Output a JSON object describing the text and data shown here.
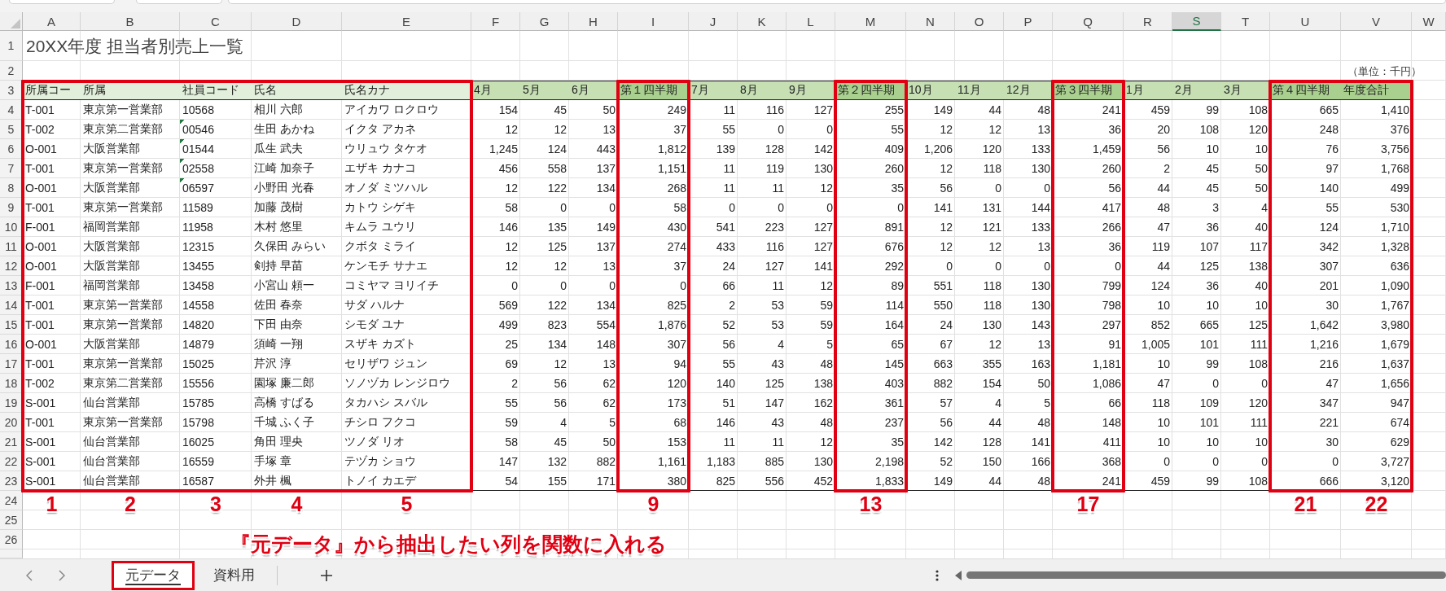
{
  "columns": [
    {
      "letter": "A",
      "selected": false,
      "highlighted": true,
      "marker": "1"
    },
    {
      "letter": "B",
      "selected": false,
      "highlighted": true,
      "marker": "2"
    },
    {
      "letter": "C",
      "selected": false,
      "highlighted": true,
      "marker": "3"
    },
    {
      "letter": "D",
      "selected": false,
      "highlighted": true,
      "marker": "4"
    },
    {
      "letter": "E",
      "selected": false,
      "highlighted": true,
      "marker": "5"
    },
    {
      "letter": "F",
      "selected": false,
      "highlighted": false
    },
    {
      "letter": "G",
      "selected": false,
      "highlighted": false
    },
    {
      "letter": "H",
      "selected": false,
      "highlighted": false
    },
    {
      "letter": "I",
      "selected": false,
      "highlighted": true,
      "marker": "9"
    },
    {
      "letter": "J",
      "selected": false,
      "highlighted": false
    },
    {
      "letter": "K",
      "selected": false,
      "highlighted": false
    },
    {
      "letter": "L",
      "selected": false,
      "highlighted": false
    },
    {
      "letter": "M",
      "selected": false,
      "highlighted": true,
      "marker": "13"
    },
    {
      "letter": "N",
      "selected": false,
      "highlighted": false
    },
    {
      "letter": "O",
      "selected": false,
      "highlighted": false
    },
    {
      "letter": "P",
      "selected": false,
      "highlighted": false
    },
    {
      "letter": "Q",
      "selected": false,
      "highlighted": true,
      "marker": "17"
    },
    {
      "letter": "R",
      "selected": false,
      "highlighted": false
    },
    {
      "letter": "S",
      "selected": true,
      "highlighted": false
    },
    {
      "letter": "T",
      "selected": false,
      "highlighted": false
    },
    {
      "letter": "U",
      "selected": false,
      "highlighted": true,
      "marker": "21"
    },
    {
      "letter": "V",
      "selected": false,
      "highlighted": true,
      "marker": "22"
    },
    {
      "letter": "W",
      "selected": false,
      "highlighted": false
    }
  ],
  "row_numbers": [
    "1",
    "2",
    "3",
    "4",
    "5",
    "6",
    "7",
    "8",
    "9",
    "10",
    "11",
    "12",
    "13",
    "14",
    "15",
    "16",
    "17",
    "18",
    "19",
    "20",
    "21",
    "22",
    "23",
    "24",
    "25",
    "26"
  ],
  "title": "20XX年度 担当者別売上一覧",
  "unit_note": "（単位：千円）",
  "header": [
    {
      "text": "所属コー",
      "kind": "text"
    },
    {
      "text": "所属",
      "kind": "text"
    },
    {
      "text": "社員コード",
      "kind": "text"
    },
    {
      "text": "氏名",
      "kind": "text"
    },
    {
      "text": "氏名カナ",
      "kind": "text"
    },
    {
      "text": "4月",
      "kind": "month"
    },
    {
      "text": "5月",
      "kind": "month"
    },
    {
      "text": "6月",
      "kind": "month"
    },
    {
      "text": "第１四半期",
      "kind": "quarter"
    },
    {
      "text": "7月",
      "kind": "month"
    },
    {
      "text": "8月",
      "kind": "month"
    },
    {
      "text": "9月",
      "kind": "month"
    },
    {
      "text": "第２四半期",
      "kind": "quarter"
    },
    {
      "text": "10月",
      "kind": "month"
    },
    {
      "text": "11月",
      "kind": "month"
    },
    {
      "text": "12月",
      "kind": "month"
    },
    {
      "text": "第３四半期",
      "kind": "quarter"
    },
    {
      "text": "1月",
      "kind": "month"
    },
    {
      "text": "2月",
      "kind": "month"
    },
    {
      "text": "3月",
      "kind": "month"
    },
    {
      "text": "第４四半期",
      "kind": "quarter"
    },
    {
      "text": "年度合計",
      "kind": "quarter"
    }
  ],
  "rows": [
    {
      "cells": [
        "T-001",
        "東京第一営業部",
        "10568",
        "相川 六郎",
        "アイカワ ロクロウ",
        "154",
        "45",
        "50",
        "249",
        "11",
        "116",
        "127",
        "255",
        "149",
        "44",
        "48",
        "241",
        "459",
        "99",
        "108",
        "665",
        "1,410"
      ],
      "code_flag": false
    },
    {
      "cells": [
        "T-002",
        "東京第二営業部",
        "00546",
        "生田 あかね",
        "イクタ アカネ",
        "12",
        "12",
        "13",
        "37",
        "55",
        "0",
        "0",
        "55",
        "12",
        "12",
        "13",
        "36",
        "20",
        "108",
        "120",
        "248",
        "376"
      ],
      "code_flag": true
    },
    {
      "cells": [
        "O-001",
        "大阪営業部",
        "01544",
        "瓜生 武夫",
        "ウリュウ タケオ",
        "1,245",
        "124",
        "443",
        "1,812",
        "139",
        "128",
        "142",
        "409",
        "1,206",
        "120",
        "133",
        "1,459",
        "56",
        "10",
        "10",
        "76",
        "3,756"
      ],
      "code_flag": true
    },
    {
      "cells": [
        "T-001",
        "東京第一営業部",
        "02558",
        "江崎 加奈子",
        "エザキ カナコ",
        "456",
        "558",
        "137",
        "1,151",
        "11",
        "119",
        "130",
        "260",
        "12",
        "118",
        "130",
        "260",
        "2",
        "45",
        "50",
        "97",
        "1,768"
      ],
      "code_flag": true
    },
    {
      "cells": [
        "O-001",
        "大阪営業部",
        "06597",
        "小野田 光春",
        "オノダ ミツハル",
        "12",
        "122",
        "134",
        "268",
        "11",
        "11",
        "12",
        "35",
        "56",
        "0",
        "0",
        "56",
        "44",
        "45",
        "50",
        "140",
        "499"
      ],
      "code_flag": true
    },
    {
      "cells": [
        "T-001",
        "東京第一営業部",
        "11589",
        "加藤 茂樹",
        "カトウ シゲキ",
        "58",
        "0",
        "0",
        "58",
        "0",
        "0",
        "0",
        "0",
        "141",
        "131",
        "144",
        "417",
        "48",
        "3",
        "4",
        "55",
        "530"
      ],
      "code_flag": false
    },
    {
      "cells": [
        "F-001",
        "福岡営業部",
        "11958",
        "木村 悠里",
        "キムラ ユウリ",
        "146",
        "135",
        "149",
        "430",
        "541",
        "223",
        "127",
        "891",
        "12",
        "121",
        "133",
        "266",
        "47",
        "36",
        "40",
        "124",
        "1,710"
      ],
      "code_flag": false
    },
    {
      "cells": [
        "O-001",
        "大阪営業部",
        "12315",
        "久保田 みらい",
        "クボタ ミライ",
        "12",
        "125",
        "137",
        "274",
        "433",
        "116",
        "127",
        "676",
        "12",
        "12",
        "13",
        "36",
        "119",
        "107",
        "117",
        "342",
        "1,328"
      ],
      "code_flag": false
    },
    {
      "cells": [
        "O-001",
        "大阪営業部",
        "13455",
        "剣持 早苗",
        "ケンモチ サナエ",
        "12",
        "12",
        "13",
        "37",
        "24",
        "127",
        "141",
        "292",
        "0",
        "0",
        "0",
        "0",
        "44",
        "125",
        "138",
        "307",
        "636"
      ],
      "code_flag": false
    },
    {
      "cells": [
        "F-001",
        "福岡営業部",
        "13458",
        "小宮山 頼一",
        "コミヤマ ヨリイチ",
        "0",
        "0",
        "0",
        "0",
        "66",
        "11",
        "12",
        "89",
        "551",
        "118",
        "130",
        "799",
        "124",
        "36",
        "40",
        "201",
        "1,090"
      ],
      "code_flag": false
    },
    {
      "cells": [
        "T-001",
        "東京第一営業部",
        "14558",
        "佐田 春奈",
        "サダ ハルナ",
        "569",
        "122",
        "134",
        "825",
        "2",
        "53",
        "59",
        "114",
        "550",
        "118",
        "130",
        "798",
        "10",
        "10",
        "10",
        "30",
        "1,767"
      ],
      "code_flag": false
    },
    {
      "cells": [
        "T-001",
        "東京第一営業部",
        "14820",
        "下田 由奈",
        "シモダ ユナ",
        "499",
        "823",
        "554",
        "1,876",
        "52",
        "53",
        "59",
        "164",
        "24",
        "130",
        "143",
        "297",
        "852",
        "665",
        "125",
        "1,642",
        "3,980"
      ],
      "code_flag": false
    },
    {
      "cells": [
        "O-001",
        "大阪営業部",
        "14879",
        "須崎 一翔",
        "スザキ カズト",
        "25",
        "134",
        "148",
        "307",
        "56",
        "4",
        "5",
        "65",
        "67",
        "12",
        "13",
        "91",
        "1,005",
        "101",
        "111",
        "1,216",
        "1,679"
      ],
      "code_flag": false
    },
    {
      "cells": [
        "T-001",
        "東京第一営業部",
        "15025",
        "芹沢 淳",
        "セリザワ ジュン",
        "69",
        "12",
        "13",
        "94",
        "55",
        "43",
        "48",
        "145",
        "663",
        "355",
        "163",
        "1,181",
        "10",
        "99",
        "108",
        "216",
        "1,637"
      ],
      "code_flag": false
    },
    {
      "cells": [
        "T-002",
        "東京第二営業部",
        "15556",
        "園塚 廉二郎",
        "ソノヅカ レンジロウ",
        "2",
        "56",
        "62",
        "120",
        "140",
        "125",
        "138",
        "403",
        "882",
        "154",
        "50",
        "1,086",
        "47",
        "0",
        "0",
        "47",
        "1,656"
      ],
      "code_flag": false
    },
    {
      "cells": [
        "S-001",
        "仙台営業部",
        "15785",
        "高橋 すばる",
        "タカハシ スバル",
        "55",
        "56",
        "62",
        "173",
        "51",
        "147",
        "162",
        "361",
        "57",
        "4",
        "5",
        "66",
        "118",
        "109",
        "120",
        "347",
        "947"
      ],
      "code_flag": false
    },
    {
      "cells": [
        "T-001",
        "東京第一営業部",
        "15798",
        "千城 ふく子",
        "チシロ フクコ",
        "59",
        "4",
        "5",
        "68",
        "146",
        "43",
        "48",
        "237",
        "56",
        "44",
        "48",
        "148",
        "10",
        "101",
        "111",
        "221",
        "674"
      ],
      "code_flag": false
    },
    {
      "cells": [
        "S-001",
        "仙台営業部",
        "16025",
        "角田 理央",
        "ツノダ リオ",
        "58",
        "45",
        "50",
        "153",
        "11",
        "11",
        "12",
        "35",
        "142",
        "128",
        "141",
        "411",
        "10",
        "10",
        "10",
        "30",
        "629"
      ],
      "code_flag": false
    },
    {
      "cells": [
        "S-001",
        "仙台営業部",
        "16559",
        "手塚 章",
        "テヅカ ショウ",
        "147",
        "132",
        "882",
        "1,161",
        "1,183",
        "885",
        "130",
        "2,198",
        "52",
        "150",
        "166",
        "368",
        "0",
        "0",
        "0",
        "0",
        "3,727"
      ],
      "code_flag": false
    },
    {
      "cells": [
        "S-001",
        "仙台営業部",
        "16587",
        "外井 楓",
        "トノイ カエデ",
        "54",
        "155",
        "171",
        "380",
        "825",
        "556",
        "452",
        "1,833",
        "149",
        "44",
        "48",
        "241",
        "459",
        "99",
        "108",
        "666",
        "3,120"
      ],
      "code_flag": false
    }
  ],
  "annotation_caption": "『元データ』から抽出したい列を関数に入れる",
  "sheet_tabs": [
    {
      "label": "元データ",
      "selected": true,
      "highlighted": true
    },
    {
      "label": "資料用",
      "selected": false,
      "highlighted": false
    }
  ]
}
